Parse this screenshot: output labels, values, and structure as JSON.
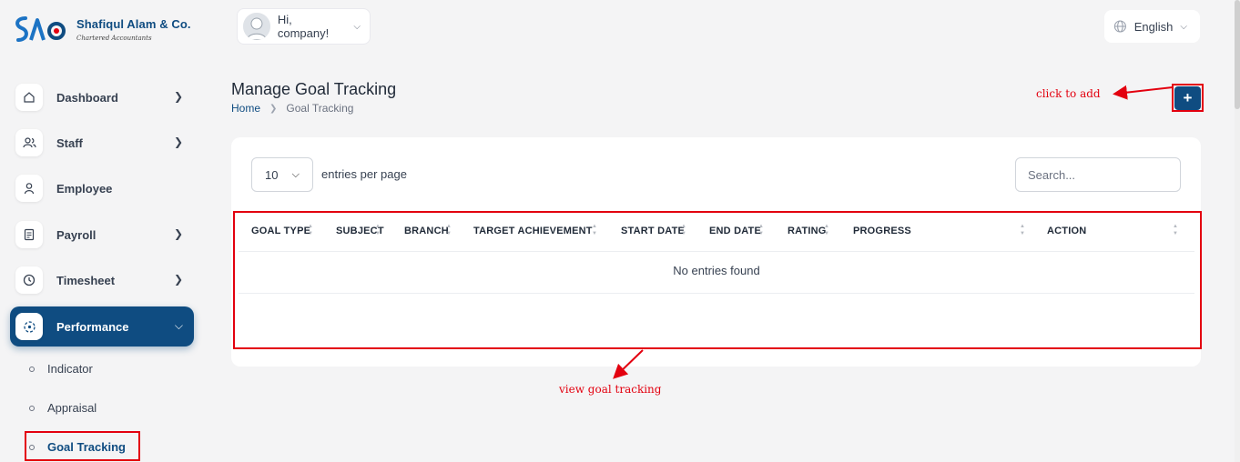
{
  "brand": {
    "name": "Shafiqul Alam & Co.",
    "subtitle": "Chartered Accountants"
  },
  "user": {
    "greeting": "Hi, company!"
  },
  "language": {
    "label": "English"
  },
  "sidebar": {
    "items": [
      {
        "label": "Dashboard",
        "icon": "home-icon",
        "has_arrow": true
      },
      {
        "label": "Staff",
        "icon": "users-icon",
        "has_arrow": true
      },
      {
        "label": "Employee",
        "icon": "user-icon",
        "has_arrow": false
      },
      {
        "label": "Payroll",
        "icon": "receipt-icon",
        "has_arrow": true
      },
      {
        "label": "Timesheet",
        "icon": "clock-icon",
        "has_arrow": true
      },
      {
        "label": "Performance",
        "icon": "target-icon",
        "has_arrow": true,
        "active": true
      }
    ],
    "sub_items": [
      "Indicator",
      "Appraisal",
      "Goal Tracking"
    ]
  },
  "page": {
    "title": "Manage Goal Tracking",
    "breadcrumb": [
      "Home",
      "Goal Tracking"
    ],
    "add_label": "+"
  },
  "table": {
    "per_page": "10",
    "per_page_label": "entries per page",
    "search_placeholder": "Search...",
    "columns": [
      "GOAL TYPE",
      "SUBJECT",
      "BRANCH",
      "TARGET ACHIEVEMENT",
      "START DATE",
      "END DATE",
      "RATING",
      "PROGRESS",
      "ACTION"
    ],
    "empty_text": "No entries found"
  },
  "annotations": {
    "add": "click to add",
    "view": "view goal tracking"
  },
  "colors": {
    "primary": "#0f4c81",
    "annotation": "#e3000f",
    "background": "#f4f4f5"
  }
}
